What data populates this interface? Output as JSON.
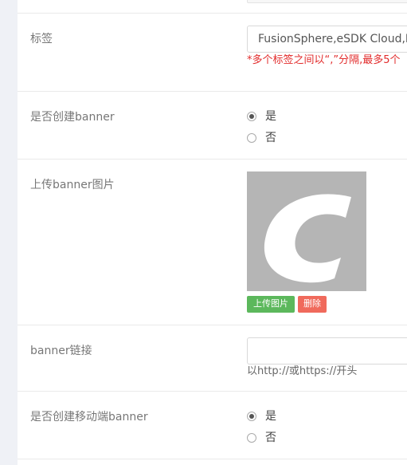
{
  "form": {
    "tags": {
      "label": "标签",
      "value": "FusionSphere,eSDK Cloud,Fu",
      "hint": "*多个标签之间以“,”分隔,最多5个"
    },
    "create_banner": {
      "label": "是否创建banner",
      "options": [
        "是",
        "否"
      ],
      "selected": "是"
    },
    "upload_banner": {
      "label": "上传banner图片",
      "upload_button": "上传图片",
      "delete_button": "删除",
      "preview_icon": "letter-c-image-icon"
    },
    "banner_link": {
      "label": "banner链接",
      "value": "",
      "hint": "以http://或https://开头"
    },
    "create_mobile_banner": {
      "label": "是否创建移动端banner",
      "options": [
        "是",
        "否"
      ],
      "selected": "是"
    }
  },
  "colors": {
    "page_background": "#eff1f6",
    "hint_red": "#e22b2b",
    "upload_button": "#5cb85c",
    "delete_button": "#f06a5c",
    "image_placeholder": "#b5b5b5"
  }
}
